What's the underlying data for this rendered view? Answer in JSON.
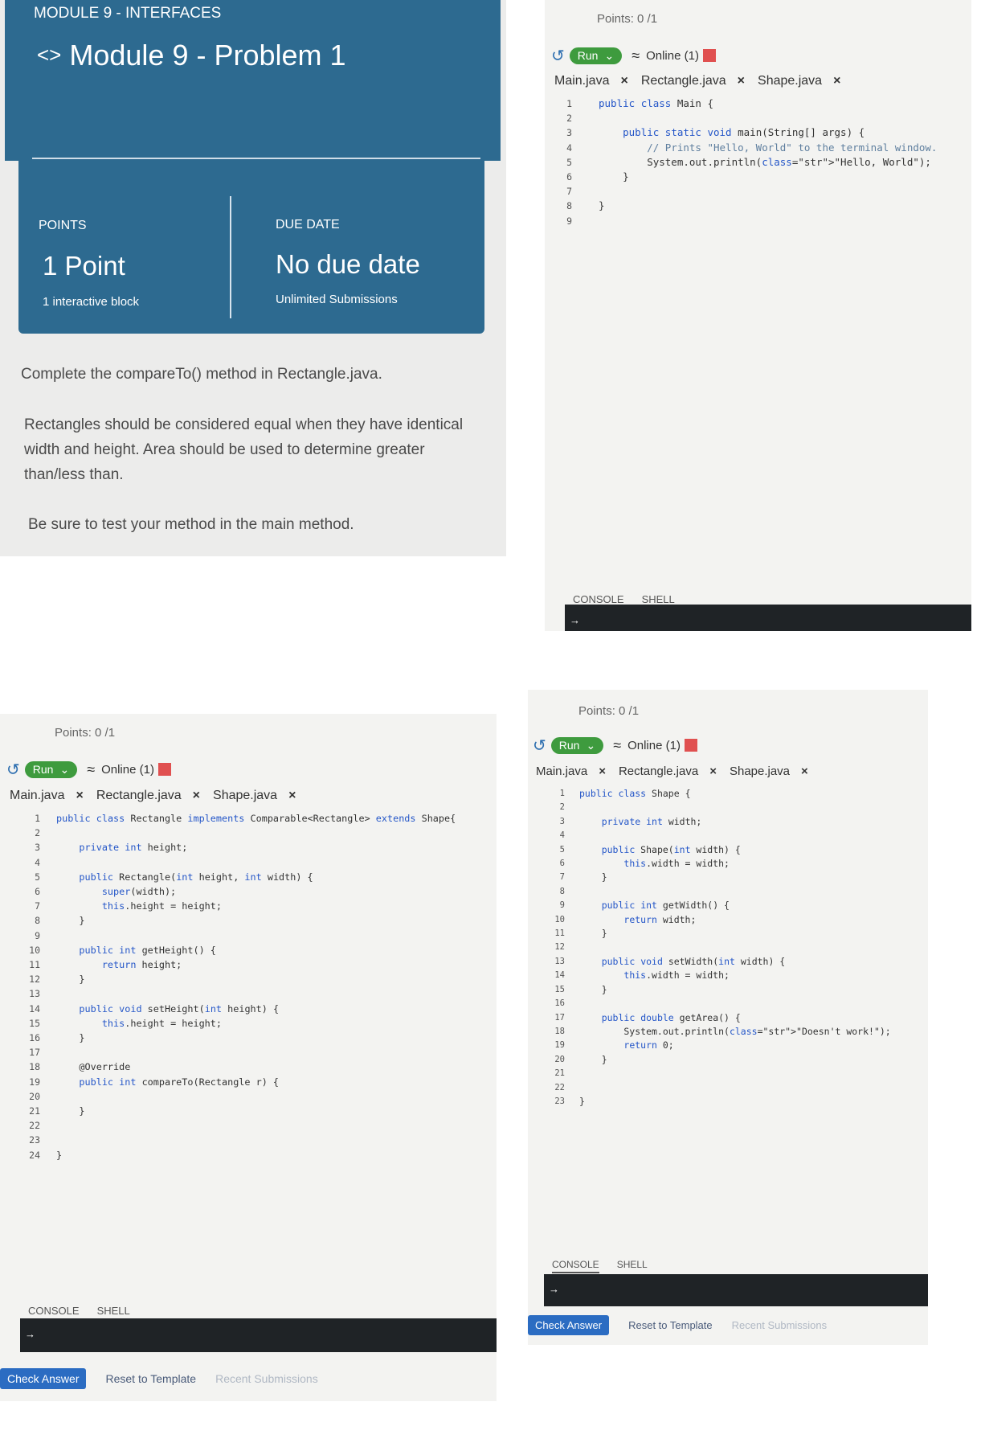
{
  "description": {
    "module_label": "MODULE 9 - INTERFACES",
    "problem_title": "Module 9 - Problem 1",
    "points_label": "POINTS",
    "points_value": "1 Point",
    "points_sub": "1 interactive block",
    "due_label": "DUE DATE",
    "due_value": "No due date",
    "due_sub": "Unlimited Submissions",
    "para1": "Complete the compareTo() method in Rectangle.java.",
    "para2": "Rectangles should be considered equal when they have identical width and height. Area should be used to determine greater than/less than.",
    "para3": "Be sure to test your method in the main method."
  },
  "ide_common": {
    "points": "Points: 0 /1",
    "run_label": "Run",
    "online_label": "Online (1)",
    "tabs": [
      "Main.java",
      "Rectangle.java",
      "Shape.java"
    ],
    "console_label": "CONSOLE",
    "shell_label": "SHELL",
    "check_answer": "Check Answer",
    "reset_template": "Reset to Template",
    "recent_submissions": "Recent Submissions"
  },
  "main_java": {
    "lines": [
      "public class Main {",
      "",
      "    public static void main(String[] args) {",
      "        // Prints \"Hello, World\" to the terminal window.",
      "        System.out.println(\"Hello, World\");",
      "    }",
      "",
      "}",
      ""
    ]
  },
  "rectangle_java": {
    "lines": [
      "public class Rectangle implements Comparable<Rectangle> extends Shape{",
      "",
      "    private int height;",
      "",
      "    public Rectangle(int height, int width) {",
      "        super(width);",
      "        this.height = height;",
      "    }",
      "",
      "    public int getHeight() {",
      "        return height;",
      "    }",
      "",
      "    public void setHeight(int height) {",
      "        this.height = height;",
      "    }",
      "",
      "    @Override",
      "    public int compareTo(Rectangle r) {",
      "",
      "    }",
      "",
      "",
      "}"
    ]
  },
  "shape_java": {
    "lines": [
      "public class Shape {",
      "",
      "    private int width;",
      "",
      "    public Shape(int width) {",
      "        this.width = width;",
      "    }",
      "",
      "    public int getWidth() {",
      "        return width;",
      "    }",
      "",
      "    public void setWidth(int width) {",
      "        this.width = width;",
      "    }",
      "",
      "    public double getArea() {",
      "        System.out.println(\"Doesn't work!\");",
      "        return 0;",
      "    }",
      "",
      "",
      "}"
    ]
  },
  "icons": {
    "code": "code-brackets-icon",
    "history": "history-icon",
    "wifi": "wifi-icon",
    "close": "close-icon",
    "chevron": "chevron-down-icon",
    "prompt": "arrow-right-icon"
  }
}
